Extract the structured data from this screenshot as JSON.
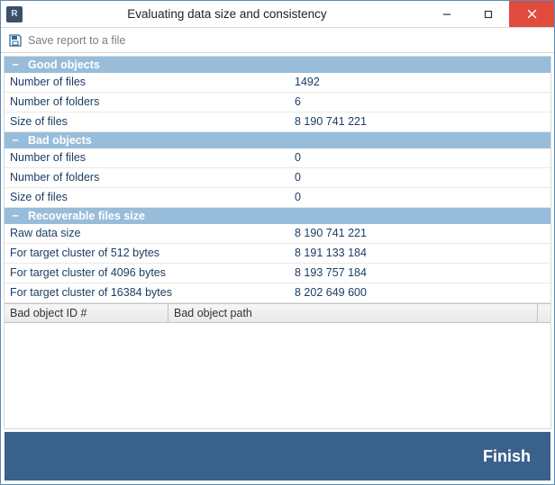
{
  "window": {
    "title": "Evaluating data size and consistency"
  },
  "toolbar": {
    "save_label": "Save report to a file"
  },
  "sections": {
    "good": {
      "title": "Good objects",
      "rows": {
        "files_label": "Number of files",
        "files_value": "1492",
        "folders_label": "Number of folders",
        "folders_value": "6",
        "size_label": "Size of files",
        "size_value": "8 190 741 221"
      }
    },
    "bad": {
      "title": "Bad objects",
      "rows": {
        "files_label": "Number of files",
        "files_value": "0",
        "folders_label": "Number of folders",
        "folders_value": "0",
        "size_label": "Size of files",
        "size_value": "0"
      }
    },
    "recoverable": {
      "title": "Recoverable files size",
      "rows": {
        "raw_label": "Raw data size",
        "raw_value": "8 190 741 221",
        "c512_label": "For target cluster of 512 bytes",
        "c512_value": "8 191 133 184",
        "c4096_label": "For target cluster of 4096 bytes",
        "c4096_value": "8 193 757 184",
        "c16384_label": "For target cluster of 16384 bytes",
        "c16384_value": "8 202 649 600"
      }
    }
  },
  "grid": {
    "col_id": "Bad object ID #",
    "col_path": "Bad object path"
  },
  "footer": {
    "finish_label": "Finish"
  },
  "glyphs": {
    "collapse": "−"
  }
}
